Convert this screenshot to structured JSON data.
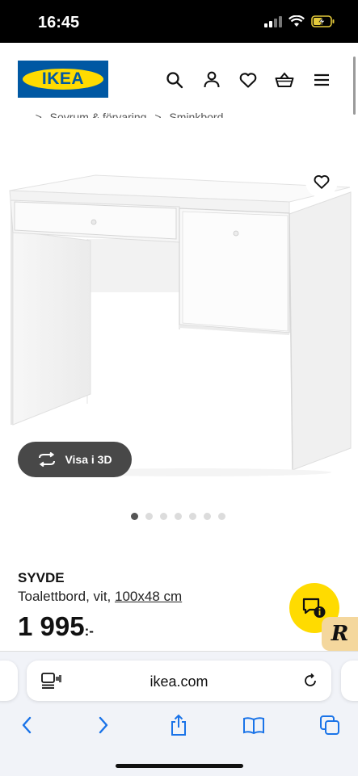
{
  "status_bar": {
    "time": "16:45"
  },
  "header": {
    "logo_text": "IKEA",
    "brand_colors": {
      "blue": "#0058a3",
      "yellow": "#ffdb00"
    },
    "icons": [
      "search-icon",
      "user-icon",
      "heart-icon",
      "basket-icon",
      "menu-icon"
    ]
  },
  "breadcrumb": [
    "...",
    ">",
    "Sovrum & förvaring",
    ">",
    "Sminkbord"
  ],
  "gallery": {
    "total_images": 7,
    "active_index": 0,
    "view3d_label": "Visa i 3D"
  },
  "product": {
    "name": "SYVDE",
    "description": "Toalettbord, vit, ",
    "dimensions": "100x48 cm",
    "price": "1 995",
    "price_suffix": ":-"
  },
  "chat": {
    "badge": "R"
  },
  "browser": {
    "url": "ikea.com"
  }
}
